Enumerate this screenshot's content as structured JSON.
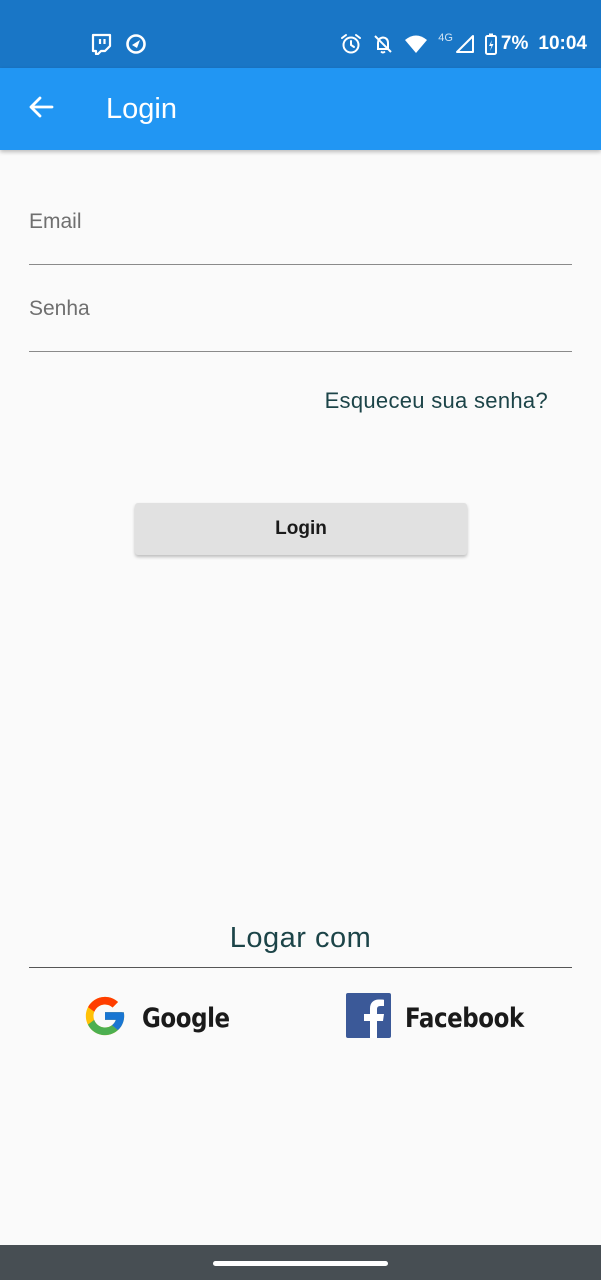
{
  "status_bar": {
    "time": "10:04",
    "battery": "7%",
    "network": "4G",
    "icons": [
      "twitch-icon",
      "app-icon",
      "alarm-icon",
      "bell-off-icon",
      "wifi-icon",
      "signal-icon",
      "battery-icon"
    ]
  },
  "app_bar": {
    "title": "Login",
    "back_icon": "arrow-back-icon"
  },
  "form": {
    "email": {
      "placeholder": "Email",
      "value": ""
    },
    "senha": {
      "placeholder": "Senha",
      "value": ""
    },
    "forgot_link": "Esqueceu sua senha?",
    "login_button": "Login"
  },
  "social": {
    "heading": "Logar com",
    "google_label": "Google",
    "facebook_label": "Facebook"
  },
  "colors": {
    "status_bar": "#1976c6",
    "app_bar": "#2196f3",
    "background": "#fafafa",
    "accent_text": "#1c4448",
    "facebook": "#3b5998"
  }
}
